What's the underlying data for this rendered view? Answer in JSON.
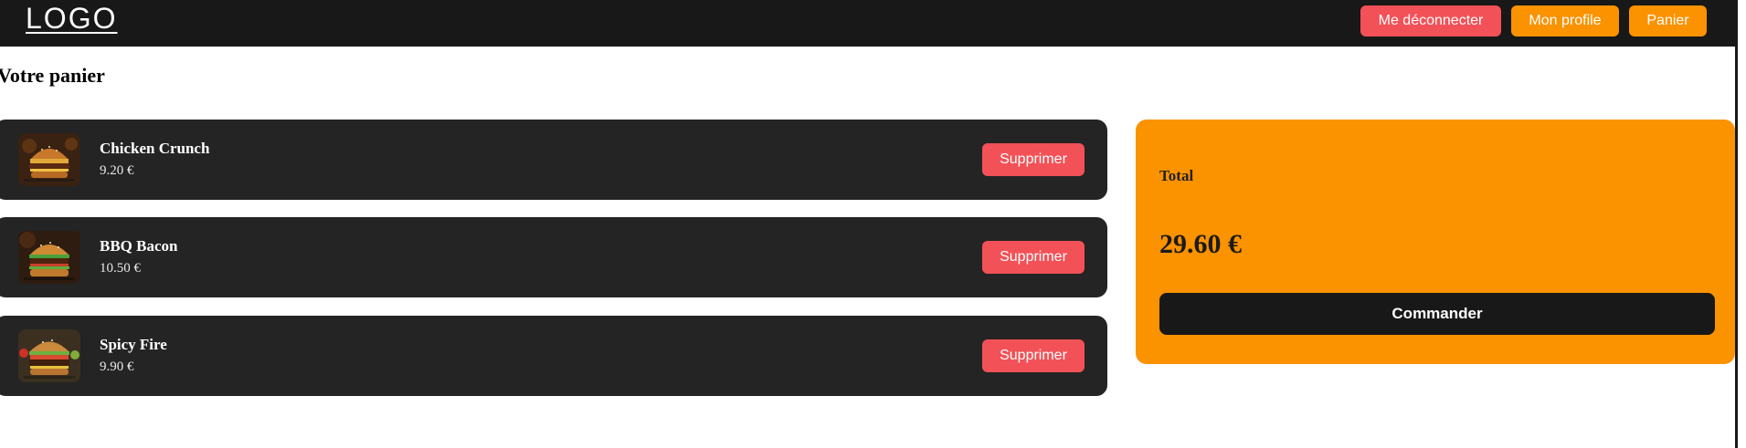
{
  "header": {
    "logo": "LOGO",
    "logout_label": "Me déconnecter",
    "profile_label": "Mon profile",
    "cart_label": "Panier"
  },
  "page": {
    "title": "Votre panier"
  },
  "cart": {
    "items": [
      {
        "name": "Chicken Crunch",
        "price": "9.20 €",
        "image": "burger-image",
        "delete_label": "Supprimer"
      },
      {
        "name": "BBQ Bacon",
        "price": "10.50 €",
        "image": "burger-image",
        "delete_label": "Supprimer"
      },
      {
        "name": "Spicy Fire",
        "price": "9.90 €",
        "image": "burger-image",
        "delete_label": "Supprimer"
      }
    ]
  },
  "summary": {
    "total_label": "Total",
    "total_value": "29.60 €",
    "order_label": "Commander"
  },
  "colors": {
    "navbar": "#181818",
    "accent_orange": "#fb9200",
    "danger_red": "#f25157",
    "card_dark": "#242424"
  }
}
